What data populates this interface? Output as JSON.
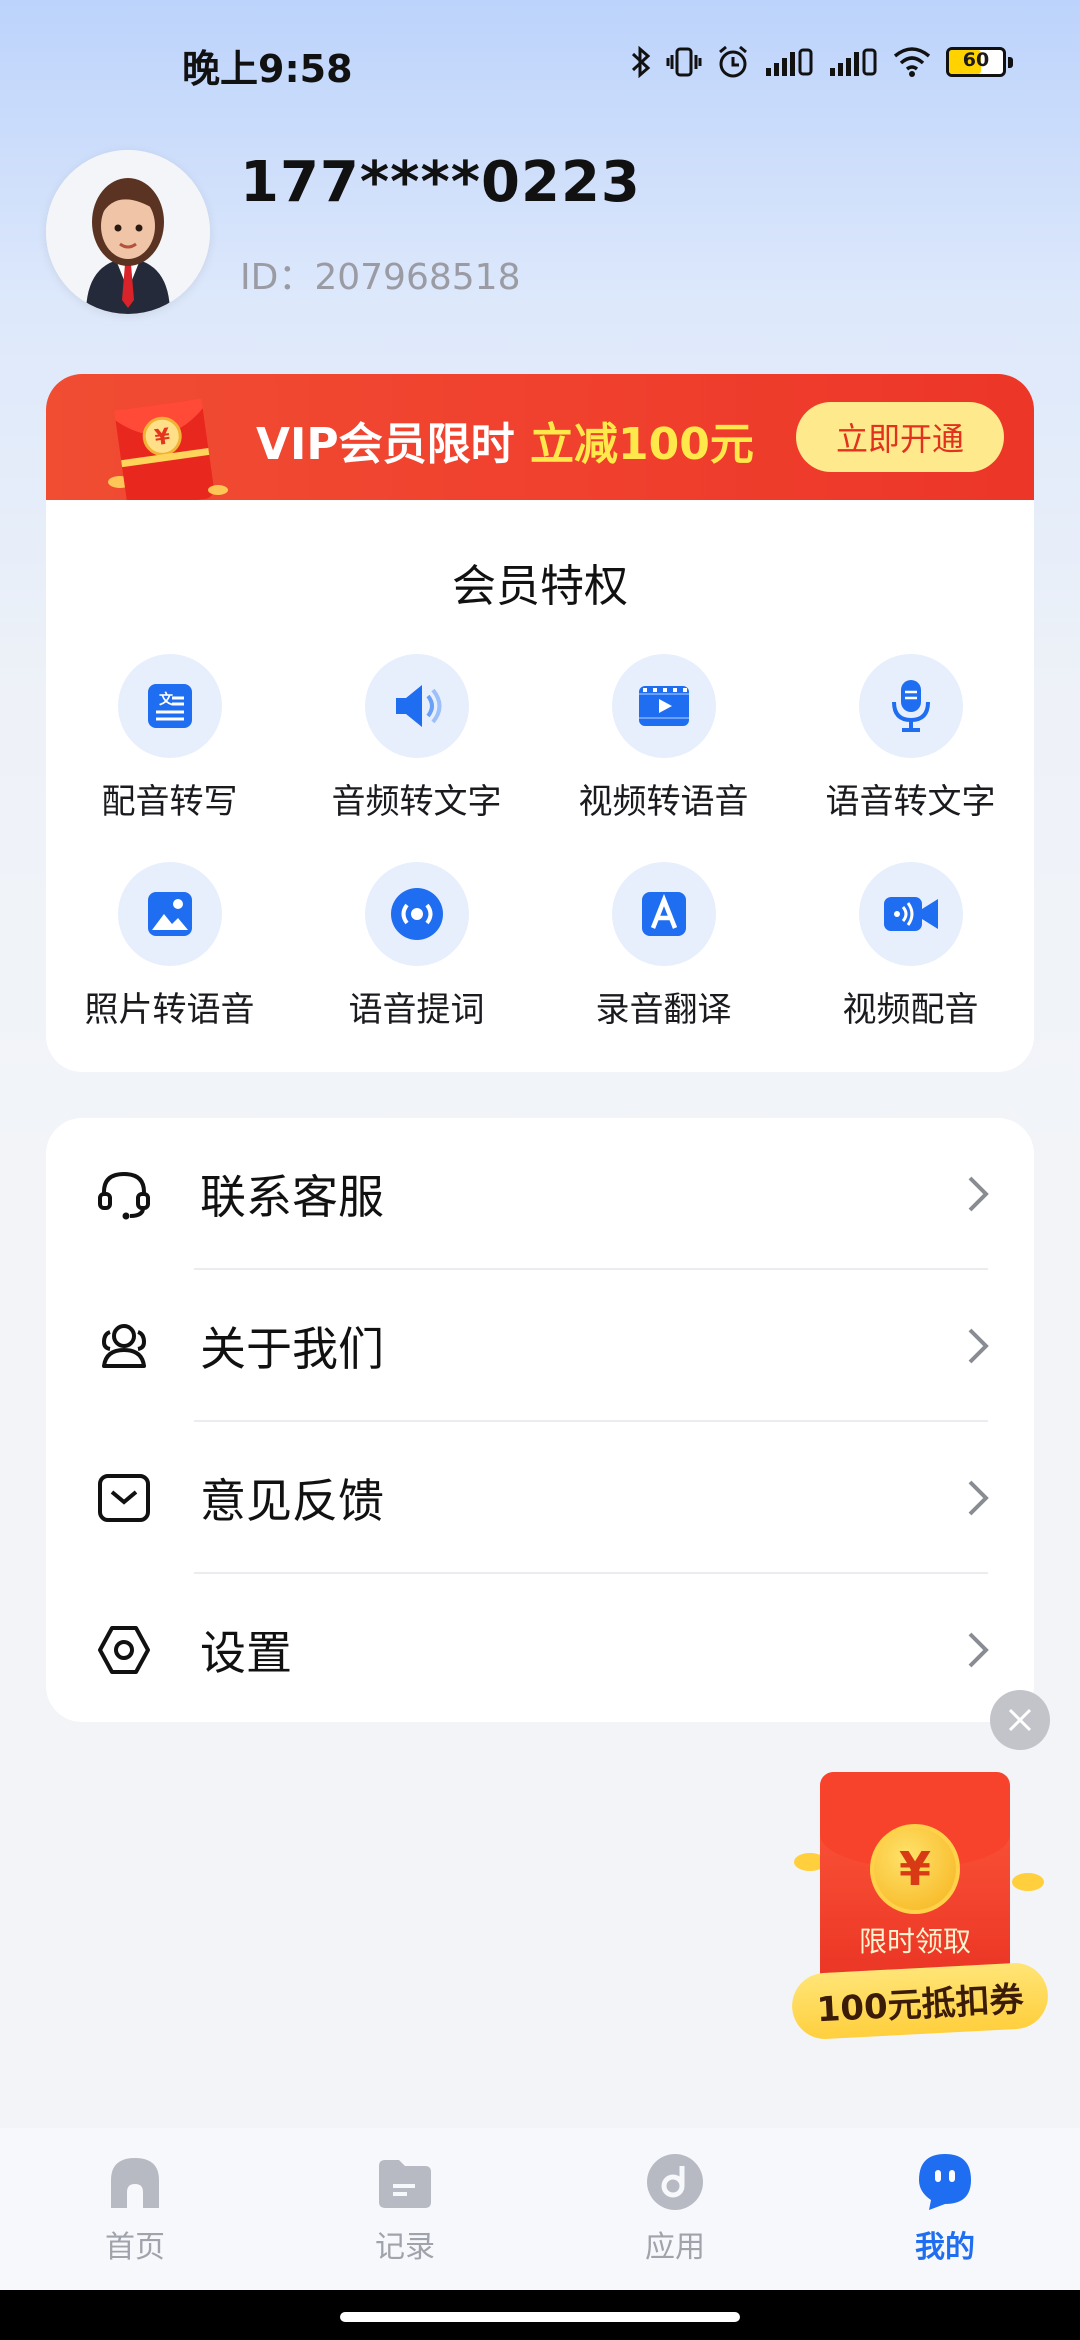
{
  "status_bar": {
    "time": "晚上9:58",
    "battery": "60",
    "battery_level": 0.6
  },
  "profile": {
    "phone": "177****0223",
    "id": "ID：207968518"
  },
  "vip": {
    "banner_text": "VIP会员限时 ",
    "banner_highlight": "立减100元",
    "cta_label": "立即开通",
    "perks_title": "会员特权",
    "perks": [
      {
        "label": "配音转写",
        "icon": "document-icon"
      },
      {
        "label": "音频转文字",
        "icon": "speaker-icon"
      },
      {
        "label": "视频转语音",
        "icon": "video-icon"
      },
      {
        "label": "语音转文字",
        "icon": "microphone-icon"
      },
      {
        "label": "照片转语音",
        "icon": "image-icon"
      },
      {
        "label": "语音提词",
        "icon": "broadcast-icon"
      },
      {
        "label": "录音翻译",
        "icon": "translate-icon"
      },
      {
        "label": "视频配音",
        "icon": "camera-icon"
      }
    ]
  },
  "menu": {
    "items": [
      {
        "label": "联系客服",
        "icon": "headset-icon"
      },
      {
        "label": "关于我们",
        "icon": "users-icon"
      },
      {
        "label": "意见反馈",
        "icon": "feedback-icon"
      },
      {
        "label": "设置",
        "icon": "settings-icon"
      }
    ]
  },
  "promo": {
    "symbol": "¥",
    "limited_text": "限时领取",
    "coupon_text": "100元抵扣券"
  },
  "tabs": [
    {
      "label": "首页",
      "icon": "home-icon"
    },
    {
      "label": "记录",
      "icon": "folder-icon"
    },
    {
      "label": "应用",
      "icon": "apps-icon"
    },
    {
      "label": "我的",
      "icon": "profile-icon",
      "active": true
    }
  ],
  "colors": {
    "accent": "#1f6df0",
    "vip_red": "#f0412e",
    "highlight_yellow": "#ffe94a"
  }
}
